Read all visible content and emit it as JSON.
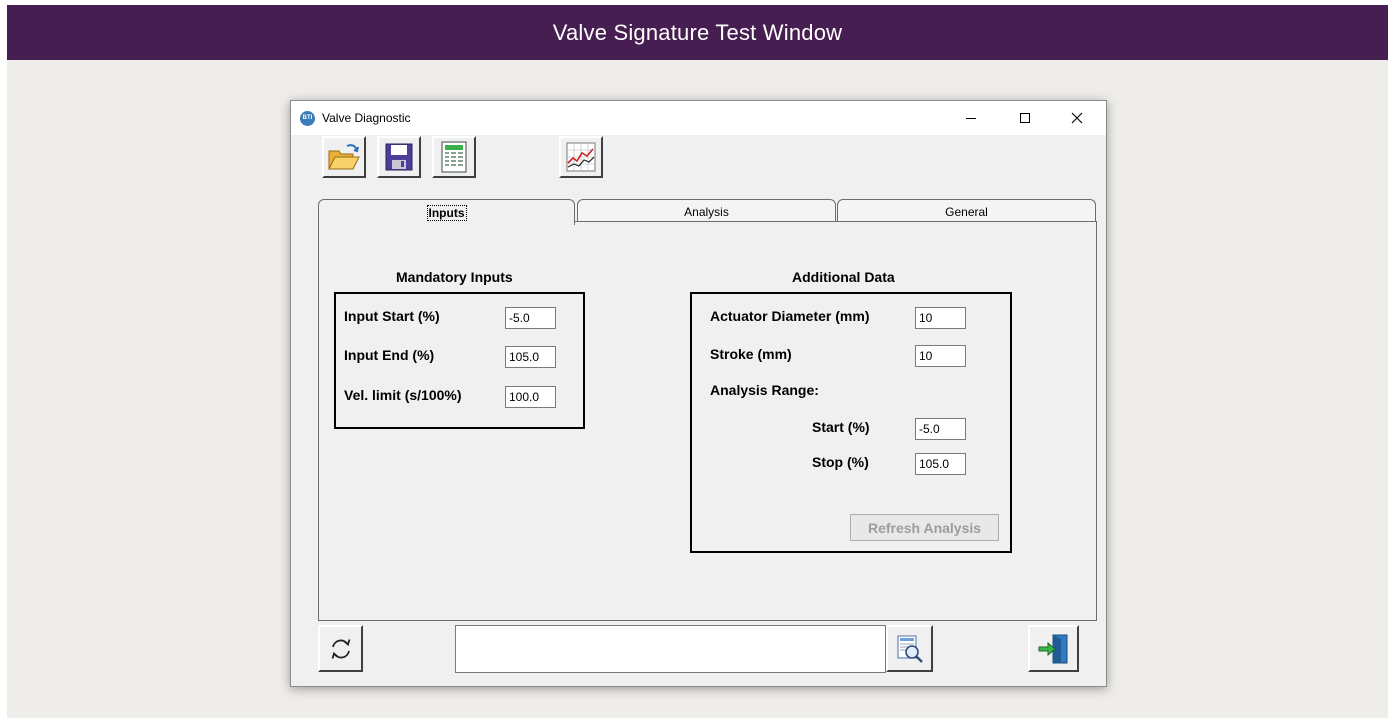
{
  "banner": {
    "title": "Valve Signature Test Window"
  },
  "window": {
    "title": "Valve Diagnostic",
    "icon_text": "BTI",
    "controls": {
      "minimize": "minimize-icon",
      "maximize": "maximize-icon",
      "close": "close-icon"
    }
  },
  "toolbar": {
    "buttons": [
      "open-folder-icon",
      "save-disk-icon",
      "spreadsheet-icon",
      "chart-icon"
    ]
  },
  "tabs": [
    {
      "label": "Inputs",
      "active": true
    },
    {
      "label": "Analysis",
      "active": false
    },
    {
      "label": "General",
      "active": false
    }
  ],
  "mandatory": {
    "heading": "Mandatory Inputs",
    "input_start_label": "Input Start (%)",
    "input_start_value": "-5.0",
    "input_end_label": "Input End (%)",
    "input_end_value": "105.0",
    "vel_limit_label": "Vel. limit (s/100%)",
    "vel_limit_value": "100.0"
  },
  "additional": {
    "heading": "Additional Data",
    "actuator_label": "Actuator Diameter (mm)",
    "actuator_value": "10",
    "stroke_label": "Stroke (mm)",
    "stroke_value": "10",
    "range_label": "Analysis Range:",
    "start_label": "Start (%)",
    "start_value": "-5.0",
    "stop_label": "Stop (%)",
    "stop_value": "105.0",
    "refresh_label": "Refresh Analysis"
  },
  "bottom": {
    "status_text": "",
    "buttons": [
      "refresh-cycle-icon",
      "magnify-document-icon",
      "exit-door-icon"
    ]
  },
  "colors": {
    "banner": "#471e51",
    "background": "#efedea",
    "window": "#f0f0f0"
  }
}
